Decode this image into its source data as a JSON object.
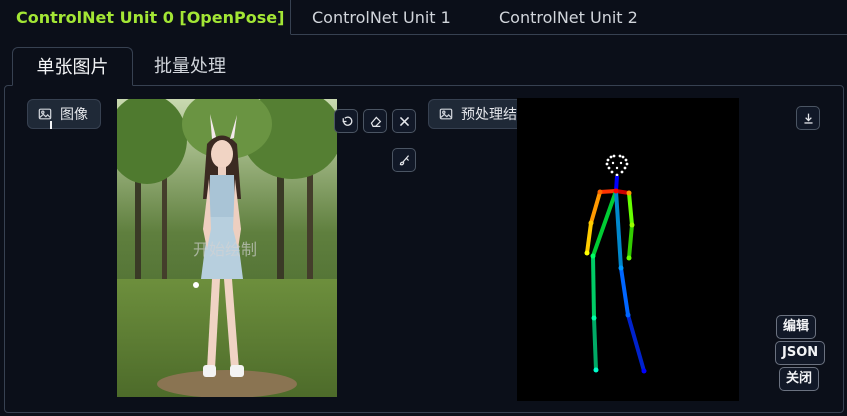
{
  "unit_tabs": [
    {
      "label": "ControlNet Unit 0 [OpenPose]",
      "active": true
    },
    {
      "label": "ControlNet Unit 1",
      "active": false
    },
    {
      "label": "ControlNet Unit 2",
      "active": false
    }
  ],
  "sub_tabs": [
    {
      "label": "单张图片",
      "active": true
    },
    {
      "label": "批量处理",
      "active": false
    }
  ],
  "image_panel": {
    "label": "图像",
    "canvas_hint": "开始绘制",
    "icons": [
      "undo-icon",
      "eraser-icon",
      "close-icon",
      "brush-icon"
    ]
  },
  "preview_panel": {
    "label": "预处理结果预览",
    "icons": [
      "download-icon"
    ],
    "buttons": {
      "edit": "编辑",
      "json": "JSON",
      "close": "关闭"
    }
  },
  "colors": {
    "accent": "#a3e635",
    "background": "#0b0f19",
    "border": "#374151"
  }
}
